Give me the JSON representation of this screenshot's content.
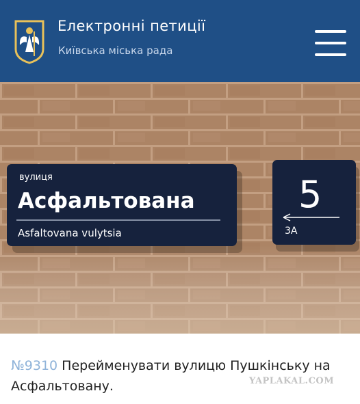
{
  "header": {
    "title": "Електронні петиції",
    "subtitle": "Київська міська рада",
    "crest_icon": "kyiv-coat-of-arms-icon",
    "menu_icon": "hamburger-menu-icon",
    "background_color": "#1f4f86"
  },
  "photo": {
    "street_sign": {
      "prefix": "вулиця",
      "name": "Асфальтована",
      "transliteration": "Asfaltovana vulytsia",
      "color": "#16223d"
    },
    "house_number_sign": {
      "number": "5",
      "next_number": "3А",
      "arrow_icon": "arrow-left-icon"
    }
  },
  "petition": {
    "number": "№9310",
    "title": "Перейменувати вулицю Пушкінську на Асфальтовану."
  },
  "watermark": "YAPLAKAL.COM"
}
